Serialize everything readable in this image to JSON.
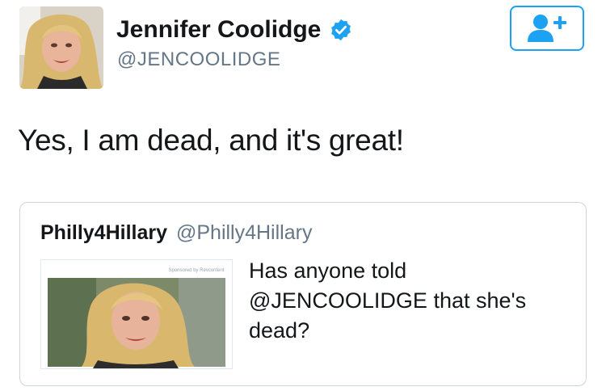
{
  "author": {
    "name": "Jennifer Coolidge",
    "handle": "@JENCOOLIDGE",
    "verified": true,
    "avatar": "profile-photo"
  },
  "follow_button": {
    "icon": "add-user-icon",
    "color": "#1da1f2"
  },
  "tweet": {
    "text": "Yes, I am dead, and it's great!"
  },
  "quoted_tweet": {
    "name": "Philly4Hillary",
    "handle": "@Philly4Hillary",
    "media_caption": "Sponsored by Revcontent",
    "text": "Has anyone told @JENCOOLIDGE that she's dead?"
  },
  "colors": {
    "accent": "#1da1f2",
    "text": "#14171a",
    "muted": "#657786",
    "border": "#ccd6dd"
  }
}
